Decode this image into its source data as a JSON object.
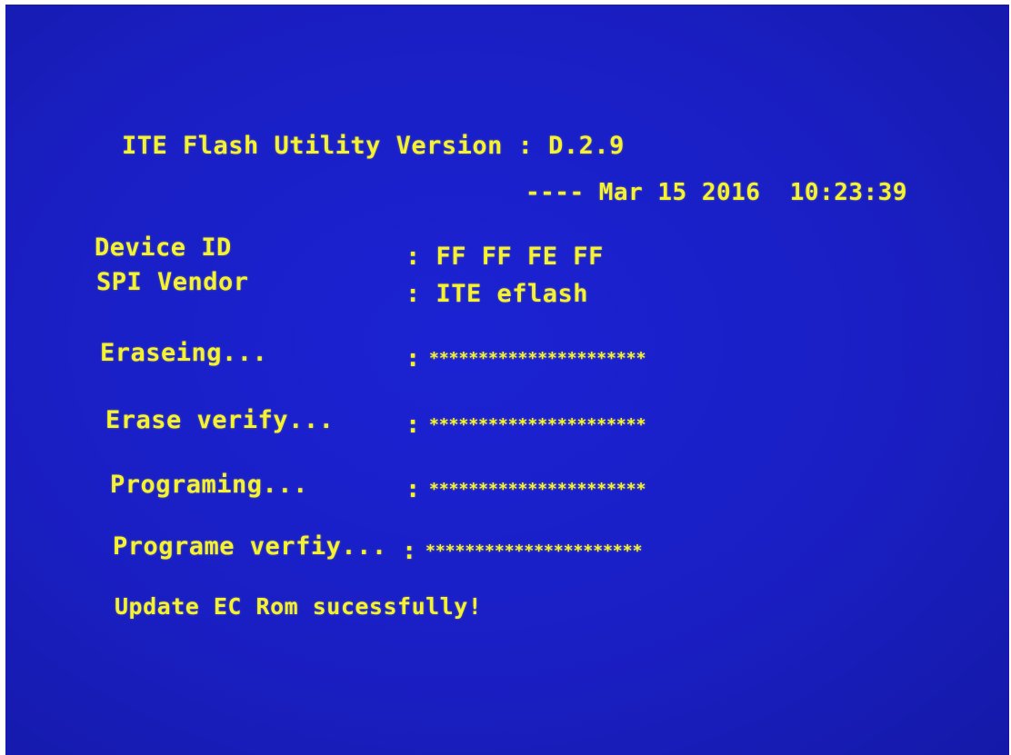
{
  "header": {
    "title": "ITE Flash Utility Version : D.2.9",
    "build_date": "---- Mar 15 2016  10:23:39"
  },
  "info": [
    {
      "label": "Device ID",
      "value": ": FF FF FE FF"
    },
    {
      "label": "SPI Vendor",
      "value": ": ITE eflash"
    }
  ],
  "steps": [
    {
      "label": "Eraseing...",
      "separator": ":",
      "progress": "**********************"
    },
    {
      "label": "Erase verify...",
      "separator": ":",
      "progress": "**********************"
    },
    {
      "label": "Programing...",
      "separator": ":",
      "progress": "**********************"
    },
    {
      "label": "Programe verfiy...",
      "separator": ":",
      "progress": "**********************"
    }
  ],
  "result": "Update EC Rom sucessfully!",
  "colors": {
    "background": "#1a1fc4",
    "text": "#f4f231"
  }
}
